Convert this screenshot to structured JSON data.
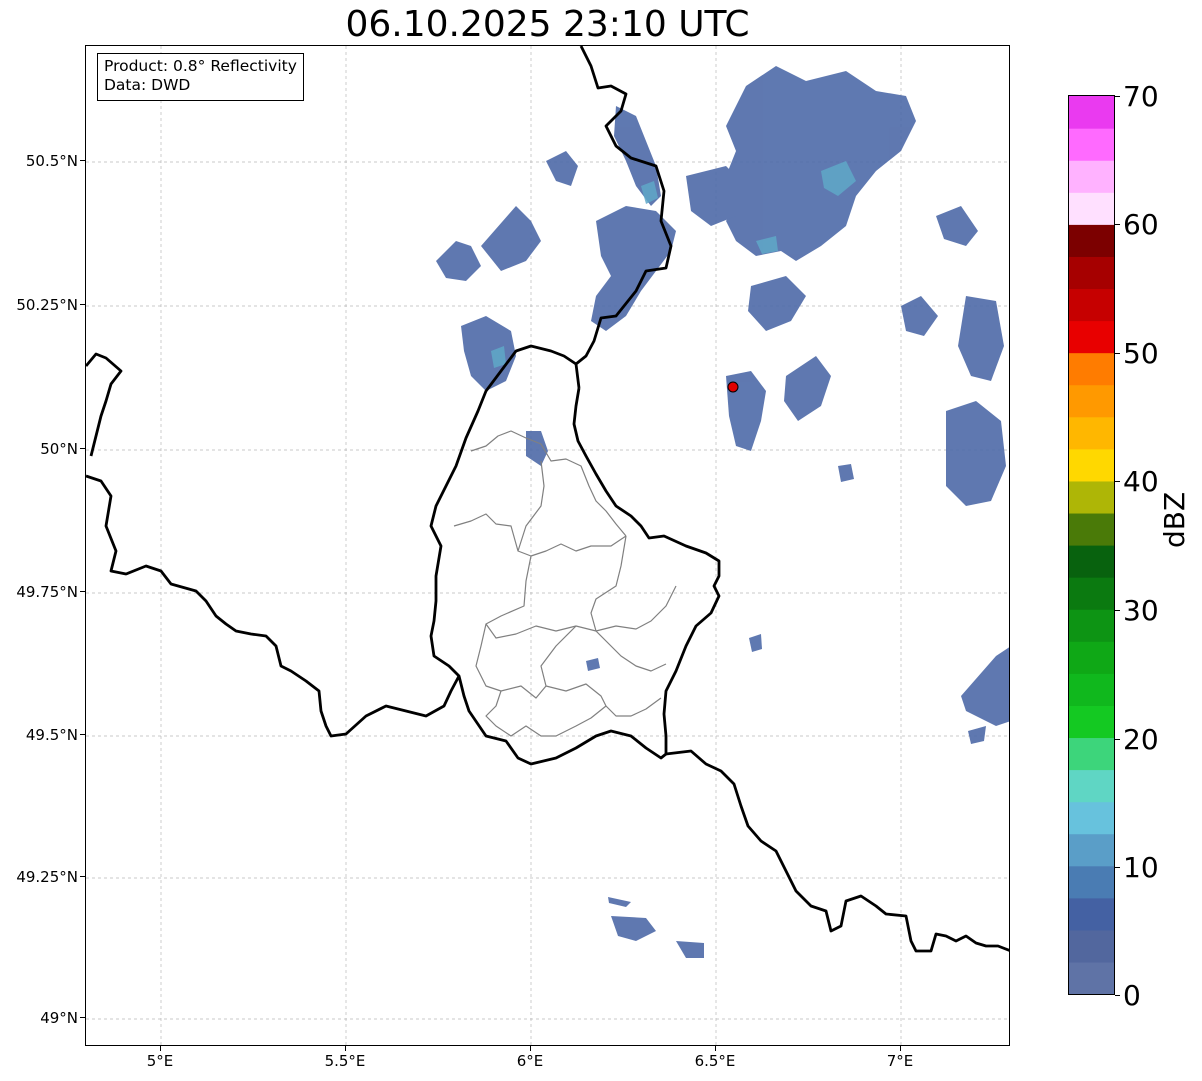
{
  "title": "06.10.2025 23:10 UTC",
  "info_box": {
    "product": "Product: 0.8° Reflectivity",
    "data_source": "Data: DWD"
  },
  "map": {
    "lon_range": [
      4.8,
      7.3
    ],
    "lat_range": [
      48.95,
      50.7
    ],
    "x_ticks": [
      "5°E",
      "5.5°E",
      "6°E",
      "6.5°E",
      "7°E"
    ],
    "y_ticks": [
      "50.5°N",
      "50.25°N",
      "50°N",
      "49.75°N",
      "49.5°N",
      "49.25°N",
      "49°N"
    ],
    "gridlines": true,
    "radar_site_marker": {
      "lon": 6.547,
      "lat": 50.11,
      "color": "#e00000"
    },
    "echo_color": "#4e6aa8",
    "border_color": "#000000",
    "district_line_color": "#808080"
  },
  "colorbar": {
    "label": "dBZ",
    "ticks": [
      "0",
      "10",
      "20",
      "30",
      "40",
      "50",
      "60",
      "70"
    ],
    "range": [
      0,
      70
    ],
    "colors": [
      "#5f73a6",
      "#52679e",
      "#4461a3",
      "#4a7cb3",
      "#5a9ec8",
      "#67c2dd",
      "#5fd6c4",
      "#3dd57b",
      "#14c922",
      "#10b81d",
      "#0fa816",
      "#0d9414",
      "#0b7a10",
      "#08620e",
      "#4a7a08",
      "#aeb606",
      "#ffd800",
      "#ffb700",
      "#ff9900",
      "#ff7c00",
      "#e80000",
      "#c60000",
      "#a60000",
      "#7c0000",
      "#ffe0ff",
      "#ffb2ff",
      "#ff6aff",
      "#ea3af0"
    ]
  }
}
